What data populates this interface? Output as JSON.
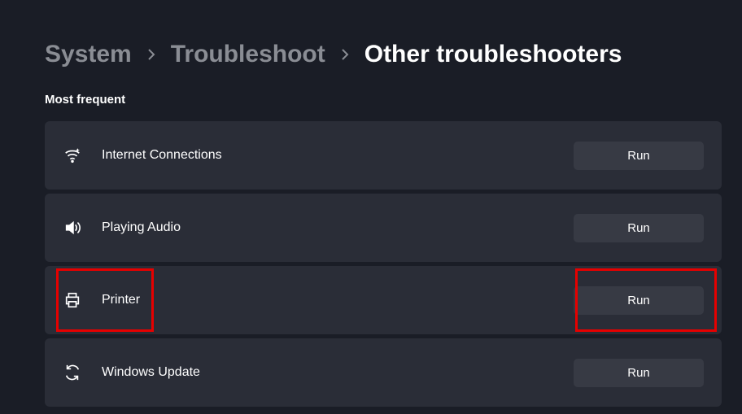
{
  "breadcrumb": {
    "items": [
      {
        "label": "System"
      },
      {
        "label": "Troubleshoot"
      },
      {
        "label": "Other troubleshooters"
      }
    ]
  },
  "section": {
    "label": "Most frequent"
  },
  "troubleshooters": [
    {
      "icon": "wifi-icon",
      "label": "Internet Connections",
      "button": "Run",
      "highlighted": false
    },
    {
      "icon": "speaker-icon",
      "label": "Playing Audio",
      "button": "Run",
      "highlighted": false
    },
    {
      "icon": "printer-icon",
      "label": "Printer",
      "button": "Run",
      "highlighted": true
    },
    {
      "icon": "sync-icon",
      "label": "Windows Update",
      "button": "Run",
      "highlighted": false
    }
  ],
  "colors": {
    "highlight": "#e60000",
    "background": "#1a1d26",
    "card": "#2a2d37",
    "button": "#373a44"
  }
}
